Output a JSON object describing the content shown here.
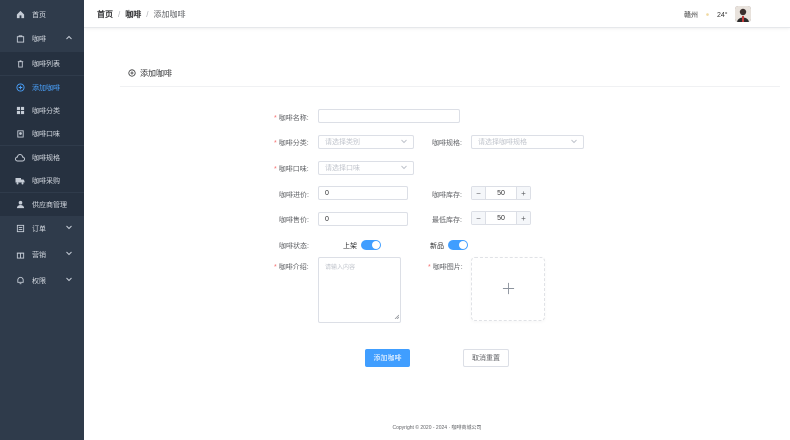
{
  "sidebar": {
    "items": [
      {
        "label": "首页",
        "icon": "home-icon"
      },
      {
        "label": "咖啡",
        "icon": "bag-icon"
      },
      {
        "label": "咖啡列表",
        "icon": "trash-icon"
      },
      {
        "label": "添加咖啡",
        "icon": "plus-circle-icon"
      },
      {
        "label": "咖啡分类",
        "icon": "grid-icon"
      },
      {
        "label": "咖啡口味",
        "icon": "badge-icon"
      },
      {
        "label": "咖啡规格",
        "icon": "cloud-icon"
      },
      {
        "label": "咖啡采购",
        "icon": "truck-icon"
      },
      {
        "label": "供应商管理",
        "icon": "user-icon"
      },
      {
        "label": "订单",
        "icon": "doc-icon"
      },
      {
        "label": "营销",
        "icon": "gift-icon"
      },
      {
        "label": "权限",
        "icon": "bell-icon"
      }
    ]
  },
  "header": {
    "breadcrumb": [
      "首页",
      "咖啡",
      "添加咖啡"
    ],
    "separator": "/",
    "city": "赣州",
    "temperature": "24°"
  },
  "form": {
    "title": "添加咖啡",
    "name_label": "咖啡名称:",
    "category_label": "咖啡分类:",
    "category_placeholder": "请选择类别",
    "spec_label": "咖啡规格:",
    "spec_placeholder": "请选择咖啡规格",
    "flavor_label": "咖啡口味:",
    "flavor_placeholder": "请选择口味",
    "purchase_price_label": "咖啡进价:",
    "purchase_price_value": "0",
    "stock_label": "咖啡库存:",
    "stock_value": "50",
    "sale_price_label": "咖啡售价:",
    "sale_price_value": "0",
    "min_stock_label": "最低库存:",
    "min_stock_value": "50",
    "status_label": "咖啡状态:",
    "on_shelf_label": "上架",
    "new_label": "新品",
    "intro_label": "咖啡介绍:",
    "intro_placeholder": "请输入内容",
    "image_label": "咖啡图片:",
    "submit": "添加咖啡",
    "reset": "取消重置",
    "minus": "−",
    "plus": "+",
    "required_mark": "*"
  },
  "footer": {
    "copyright": "Copyright © 2020 - 2024 · 咖啡商城公司"
  },
  "colors": {
    "sidebar": "#2f3b4b",
    "accent": "#409eff",
    "active_text": "#4aa3ff"
  }
}
